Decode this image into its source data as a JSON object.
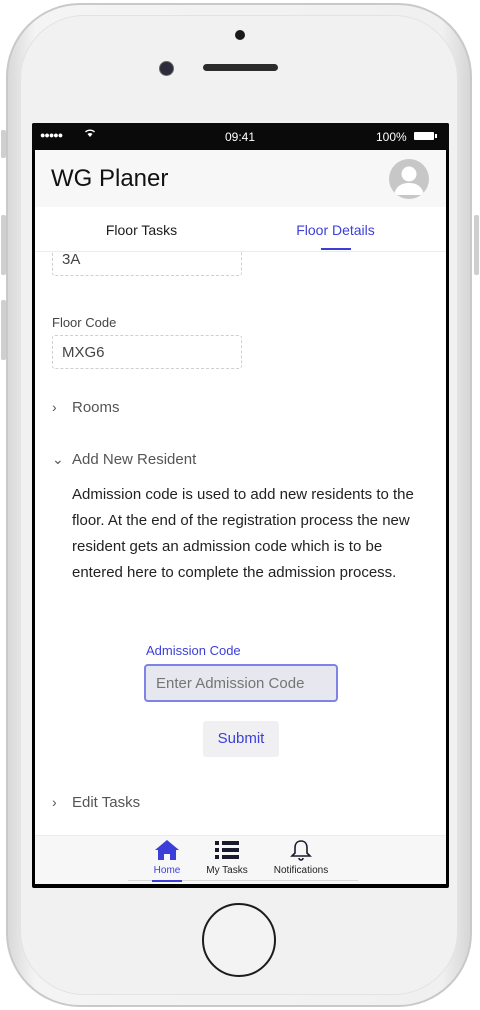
{
  "status_bar": {
    "signal": "●●●●●",
    "wifi": "ᯤ",
    "time": "09:41",
    "battery": "100%"
  },
  "header": {
    "title": "WG Planer"
  },
  "tabs": [
    {
      "label": "Floor Tasks",
      "active": false
    },
    {
      "label": "Floor Details",
      "active": true
    }
  ],
  "floor": {
    "number_value": "3A",
    "code_label": "Floor Code",
    "code_value": "MXG6"
  },
  "sections": {
    "rooms": "Rooms",
    "add_resident": "Add New Resident",
    "edit_tasks": "Edit Tasks"
  },
  "add_resident": {
    "description": "Admission code is used to add new residents to the floor. At the end of the registration process the new resident gets an admission code which is to be entered here to complete the admission process.",
    "input_label": "Admission Code",
    "input_placeholder": "Enter Admission Code",
    "submit_label": "Submit"
  },
  "bottom_nav": [
    {
      "label": "Home",
      "icon": "home-icon",
      "active": true
    },
    {
      "label": "My Tasks",
      "icon": "list-icon",
      "active": false
    },
    {
      "label": "Notifications",
      "icon": "bell-icon",
      "active": false
    }
  ],
  "colors": {
    "accent": "#3b3fd8",
    "input_bg": "#e7e7ef"
  }
}
